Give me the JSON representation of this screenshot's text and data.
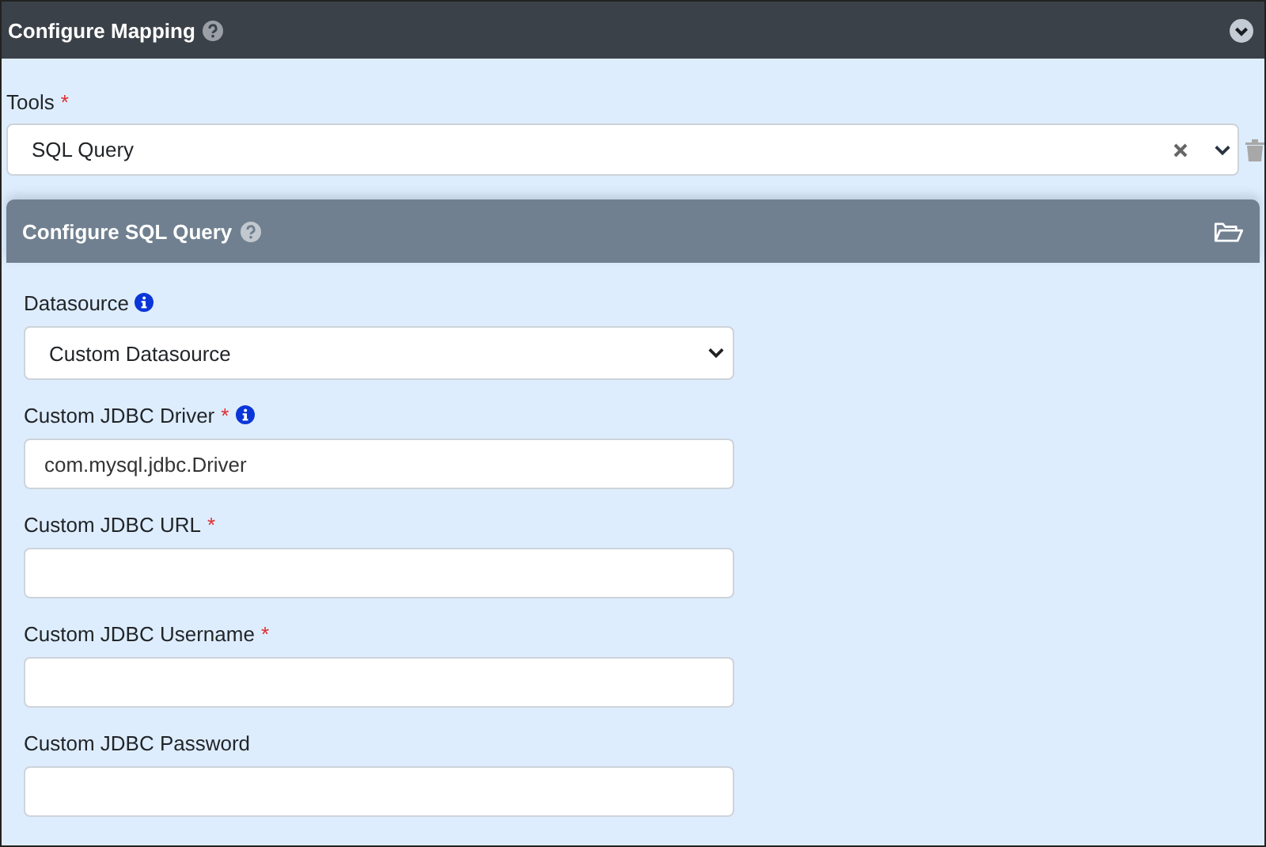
{
  "header": {
    "title": "Configure Mapping"
  },
  "tools": {
    "label": "Tools",
    "required_mark": "*",
    "value": "SQL Query"
  },
  "panel": {
    "title": "Configure SQL Query"
  },
  "fields": [
    {
      "kind": "select",
      "label": "Datasource",
      "info": true,
      "value": "Custom Datasource"
    },
    {
      "kind": "input",
      "label": "Custom JDBC Driver",
      "required_mark": "*",
      "info": true,
      "value": "com.mysql.jdbc.Driver"
    },
    {
      "kind": "input",
      "label": "Custom JDBC URL",
      "required_mark": "*",
      "info": false
    },
    {
      "kind": "input",
      "label": "Custom JDBC Username",
      "required_mark": "*",
      "info": false
    },
    {
      "kind": "input",
      "label": "Custom JDBC Password",
      "info": false
    }
  ]
}
